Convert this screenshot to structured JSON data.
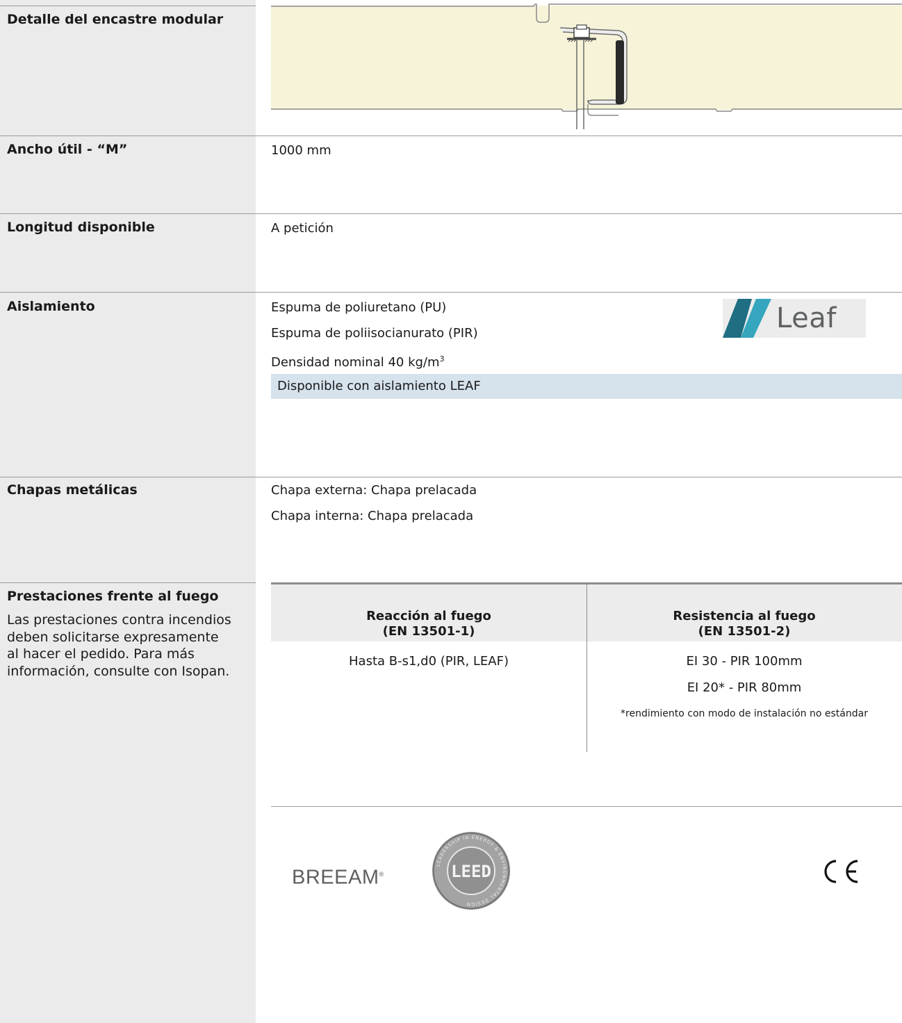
{
  "rows": {
    "joint_detail": {
      "label": "Detalle del encastre modular"
    },
    "useful_width": {
      "label": "Ancho útil - “M”",
      "value": "1000 mm"
    },
    "length": {
      "label": "Longitud disponible",
      "value": "A petición"
    },
    "insulation": {
      "label": "Aislamiento",
      "lines": [
        "Espuma de poliuretano (PU)",
        "Espuma de poliisocianurato (PIR)",
        "Densidad nominal 40 kg/m"
      ],
      "density_superscript": "3",
      "leaf_bar": "Disponible con aislamiento LEAF",
      "leaf_logo_text": "Leaf"
    },
    "metal_sheets": {
      "label": "Chapas metálicas",
      "lines": [
        "Chapa externa: Chapa prelacada",
        "Chapa interna: Chapa prelacada"
      ]
    },
    "fire": {
      "label": "Prestaciones frente al fuego",
      "note_lines": [
        "Las prestaciones contra incendios",
        "deben solicitarse expresamente",
        "al hacer el pedido. Para más",
        "información, consulte con Isopan."
      ],
      "table": {
        "headers": [
          {
            "line1": "Reacción al fuego",
            "line2": "(EN 13501-1)"
          },
          {
            "line1": "Resistencia al fuego",
            "line2": "(EN 13501-2)"
          }
        ],
        "reaction": "Hasta B-s1,d0 (PIR, LEAF)",
        "resistance": [
          "EI 30 - PIR 100mm",
          "EI 20* - PIR 80mm"
        ],
        "footnote": "*rendimiento con modo de instalación no estándar"
      }
    }
  },
  "certifications": {
    "breeam": "BREEAM",
    "breeam_mark": "®",
    "leed": "LEED",
    "leed_ring_text": "LEADERSHIP IN ENERGY & ENVIRONMENTAL DESIGN",
    "ce": "CE"
  },
  "colors": {
    "sidebar": "#ebebeb",
    "foam": "#f6f3d8",
    "leaf_bar": "#d6e2ec",
    "leaf_dark": "#1f5f72",
    "leaf_light": "#35a6bd"
  }
}
